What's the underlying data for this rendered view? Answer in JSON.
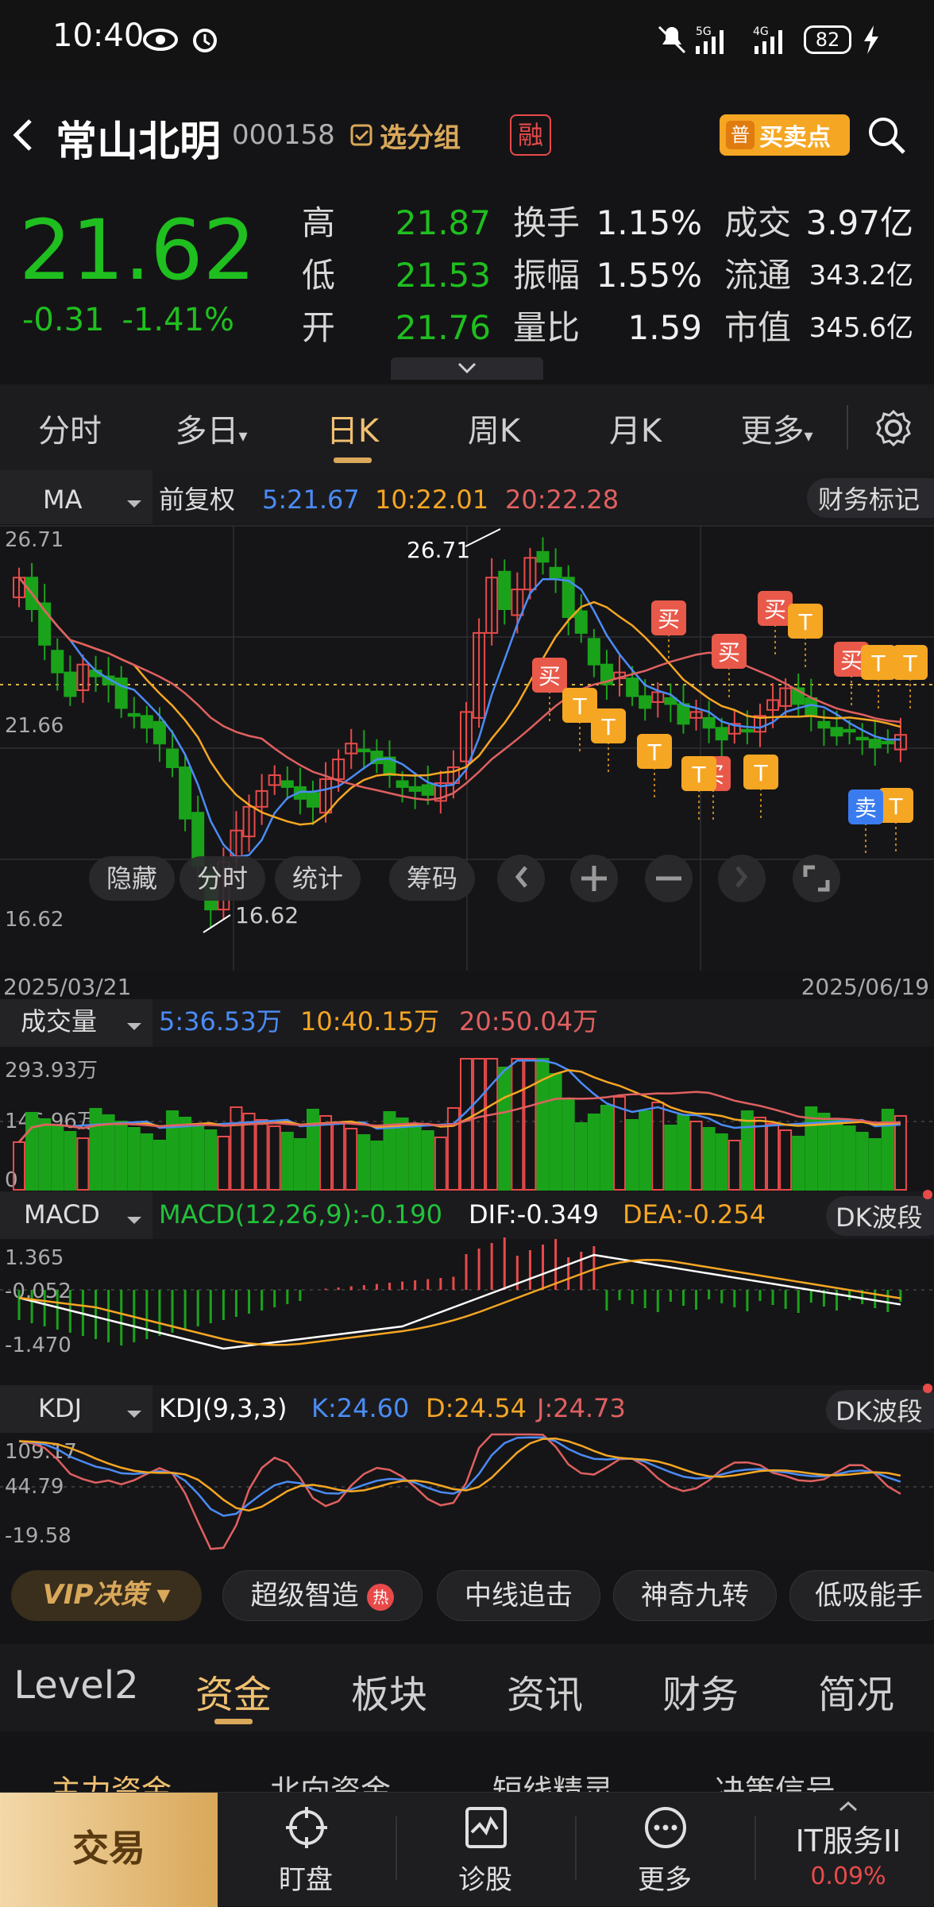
{
  "status": {
    "time": "10:40",
    "battery": "82",
    "net1": "5G",
    "net2": "4G"
  },
  "header": {
    "name": "常山北明",
    "code": "000158",
    "group_label": "选分组",
    "rong": "融",
    "bs_label": "买卖点",
    "bs_badge": "普"
  },
  "quote": {
    "price": "21.62",
    "change": "-0.31",
    "change_pct": "-1.41%",
    "rows": [
      {
        "k1": "高",
        "v1": "21.87",
        "k2": "换手",
        "v2": "1.15%",
        "k3": "成交",
        "v3": "3.97亿"
      },
      {
        "k1": "低",
        "v1": "21.53",
        "k2": "振幅",
        "v2": "1.55%",
        "k3": "流通",
        "v3": "343.2亿"
      },
      {
        "k1": "开",
        "v1": "21.76",
        "k2": "量比",
        "v2": "1.59",
        "k3": "市值",
        "v3": "345.6亿"
      }
    ]
  },
  "tabs": [
    "分时",
    "多日",
    "日K",
    "周K",
    "月K",
    "更多"
  ],
  "ma": {
    "label": "MA",
    "fq": "前复权",
    "ma5": "5:21.67",
    "ma10": "10:22.01",
    "ma20": "20:22.28",
    "fin_btn": "财务标记"
  },
  "kline": {
    "y_high": "26.71",
    "y_mid": "21.66",
    "y_low": "16.62",
    "max_mark": "26.71",
    "min_mark": "16.62",
    "date_start": "2025/03/21",
    "date_end": "2025/06/19",
    "tools": [
      "隐藏",
      "分时",
      "统计",
      "筹码"
    ],
    "mark_buy": "买",
    "mark_sell": "卖",
    "mark_t": "T"
  },
  "volume": {
    "label": "成交量",
    "ma5": "5:36.53万",
    "ma10": "10:40.15万",
    "ma20": "20:50.04万",
    "y_high": "293.93万",
    "y_mid": "146.96万",
    "y_low": "0"
  },
  "macd": {
    "label": "MACD",
    "macd": "MACD(12,26,9):-0.190",
    "dif": "DIF:-0.349",
    "dea": "DEA:-0.254",
    "btn": "DK波段",
    "y_high": "1.365",
    "y_mid": "-0.052",
    "y_low": "-1.470"
  },
  "kdj": {
    "label": "KDJ",
    "kdj": "KDJ(9,3,3)",
    "k": "K:24.60",
    "d": "D:24.54",
    "j": "J:24.73",
    "btn": "DK波段",
    "y_high": "109.17",
    "y_mid": "44.79",
    "y_low": "-19.58"
  },
  "strategy": {
    "vip": "VIP决策",
    "chips": [
      "超级智造",
      "中线追击",
      "神奇九转",
      "低吸能手"
    ],
    "hot": "热"
  },
  "ftabs": [
    "Level2",
    "资金",
    "板块",
    "资讯",
    "财务",
    "简况"
  ],
  "subtabs": [
    "主力资金",
    "北向资金",
    "短线精灵",
    "决策信号"
  ],
  "bottom": {
    "trade": "交易",
    "items": [
      "盯盘",
      "诊股",
      "更多"
    ],
    "index_name": "IT服务II",
    "index_pct": "0.09%"
  },
  "colors": {
    "up": "#e84a4a",
    "down": "#1aa31a",
    "ma5": "#4b8cf5",
    "ma10": "#f5a623",
    "ma20": "#e06060",
    "gold": "#d9a85a"
  }
}
